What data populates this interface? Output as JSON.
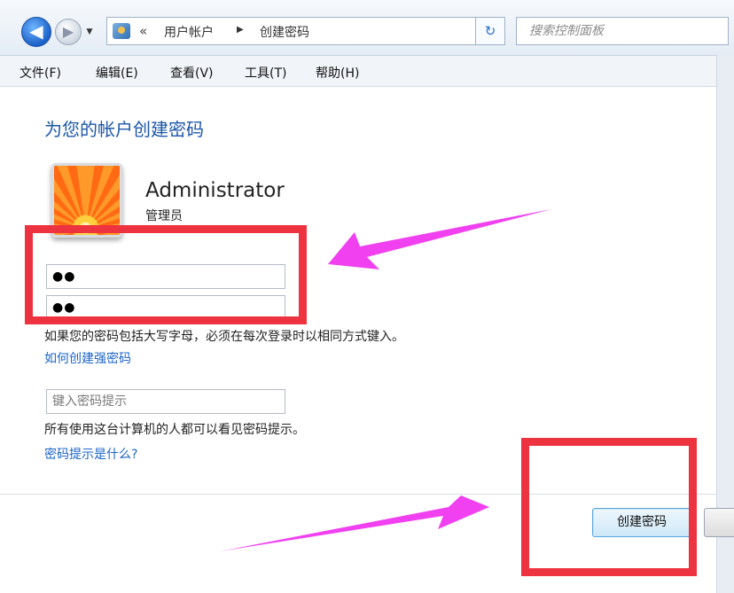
{
  "address_bar": {
    "breadcrumb_chevron": "«",
    "breadcrumb": [
      "用户帐户",
      "创建密码"
    ],
    "search_placeholder": "搜索控制面板"
  },
  "menu": [
    {
      "label": "文件(F)"
    },
    {
      "label": "编辑(E)"
    },
    {
      "label": "查看(V)"
    },
    {
      "label": "工具(T)"
    },
    {
      "label": "帮助(H)"
    }
  ],
  "page": {
    "title": "为您的帐户创建密码",
    "user": {
      "name": "Administrator",
      "role": "管理员"
    },
    "password": {
      "value": "●●"
    },
    "confirm_password": {
      "value": "●●"
    },
    "case_note": "如果您的密码包括大写字母，必须在每次登录时以相同方式键入。",
    "strong_password_link": "如何创建强密码",
    "hint_placeholder": "键入密码提示",
    "hint_note": "所有使用这台计算机的人都可以看见密码提示。",
    "hint_help_link": "密码提示是什么?",
    "create_button": "创建密码"
  },
  "annotation": {
    "box_color": "#ee3340",
    "arrow_color": "#f040f0"
  },
  "icons": [
    "back-arrow-icon",
    "forward-arrow-icon",
    "control-panel-icon",
    "refresh-icon",
    "user-avatar-icon"
  ]
}
